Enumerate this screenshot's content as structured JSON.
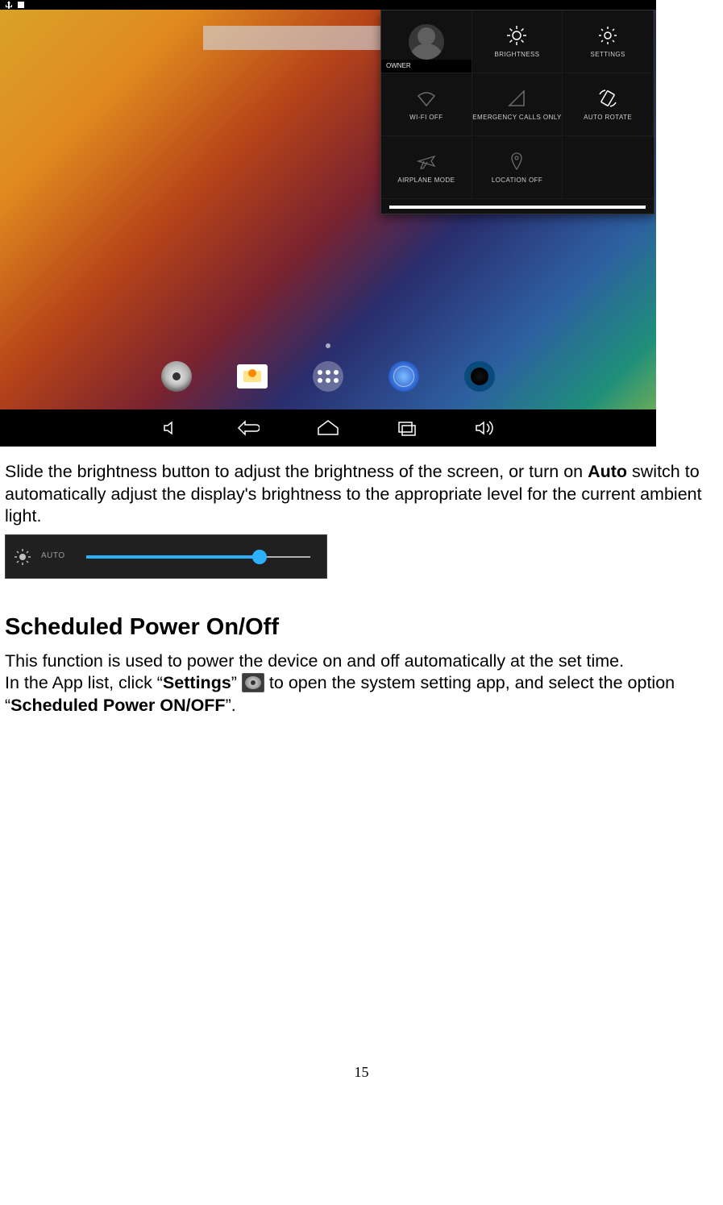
{
  "screenshot": {
    "quick_settings": {
      "owner_label": "OWNER",
      "tiles": {
        "brightness": "BRIGHTNESS",
        "settings": "SETTINGS",
        "wifi": "WI-FI OFF",
        "emergency": "EMERGENCY CALLS ONLY",
        "auto_rotate": "AUTO ROTATE",
        "airplane": "AIRPLANE MODE",
        "location": "LOCATION OFF"
      }
    }
  },
  "body": {
    "para1_a": "Slide the brightness button to adjust the brightness of the screen, or turn on ",
    "para1_bold": "Auto",
    "para1_b": " switch to automatically adjust the display's brightness to the appropriate level for the current ambient light."
  },
  "brightness_figure": {
    "auto_label": "AUTO"
  },
  "heading": "Scheduled Power On/Off",
  "body2": {
    "p1": "This function is used to power the device on and off automatically at the set time.",
    "p2a": "In the App list, click “",
    "p2b_bold": "Settings",
    "p2c": "” ",
    "p2d": " to open the system setting app, and select the option “",
    "p2e_bold": "Scheduled Power ON/OFF",
    "p2f": "”."
  },
  "page_number": "15"
}
